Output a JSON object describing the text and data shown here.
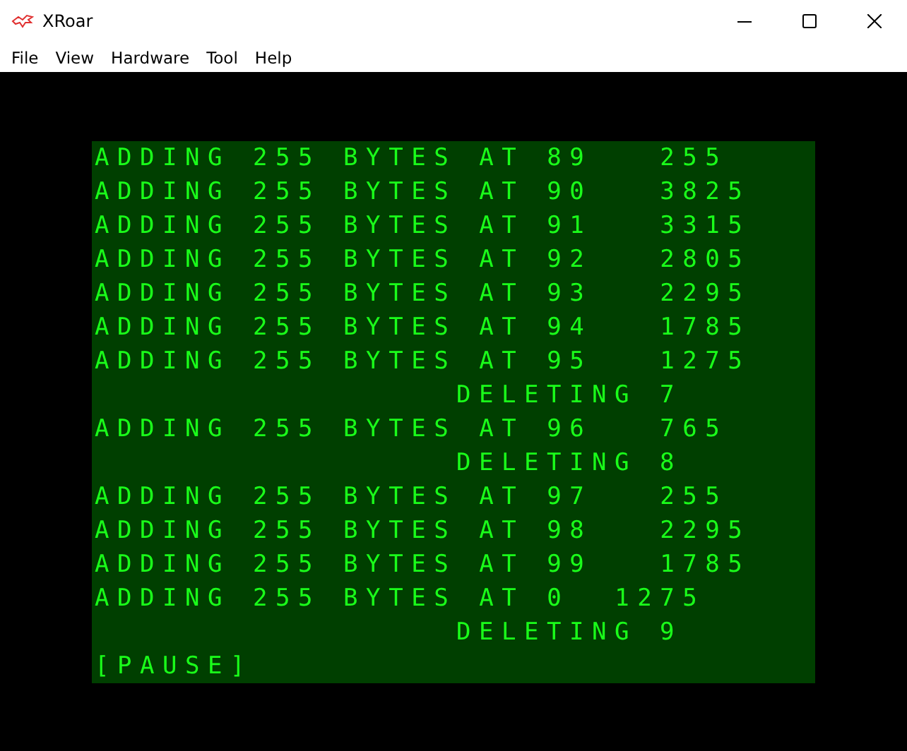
{
  "window": {
    "title": "XRoar"
  },
  "menu": [
    "File",
    "View",
    "Hardware",
    "Tool",
    "Help"
  ],
  "screen": {
    "lines": [
      {
        "kind": "output",
        "text": "ADDING 255 BYTES AT 89   255"
      },
      {
        "kind": "output",
        "text": "ADDING 255 BYTES AT 90   3825"
      },
      {
        "kind": "output",
        "text": "ADDING 255 BYTES AT 91   3315"
      },
      {
        "kind": "output",
        "text": "ADDING 255 BYTES AT 92   2805"
      },
      {
        "kind": "output",
        "text": "ADDING 255 BYTES AT 93   2295"
      },
      {
        "kind": "output",
        "text": "ADDING 255 BYTES AT 94   1785"
      },
      {
        "kind": "output",
        "text": "ADDING 255 BYTES AT 95   1275"
      },
      {
        "kind": "indented",
        "text": "DELETING 7"
      },
      {
        "kind": "output",
        "text": "ADDING 255 BYTES AT 96   765"
      },
      {
        "kind": "indented",
        "text": "DELETING 8"
      },
      {
        "kind": "output",
        "text": "ADDING 255 BYTES AT 97   255"
      },
      {
        "kind": "output",
        "text": "ADDING 255 BYTES AT 98   2295"
      },
      {
        "kind": "output",
        "text": "ADDING 255 BYTES AT 99   1785"
      },
      {
        "kind": "output",
        "text": "ADDING 255 BYTES AT 0  1275"
      },
      {
        "kind": "indented",
        "text": "DELETING 9"
      },
      {
        "kind": "output",
        "text": "[PAUSE]"
      }
    ]
  }
}
